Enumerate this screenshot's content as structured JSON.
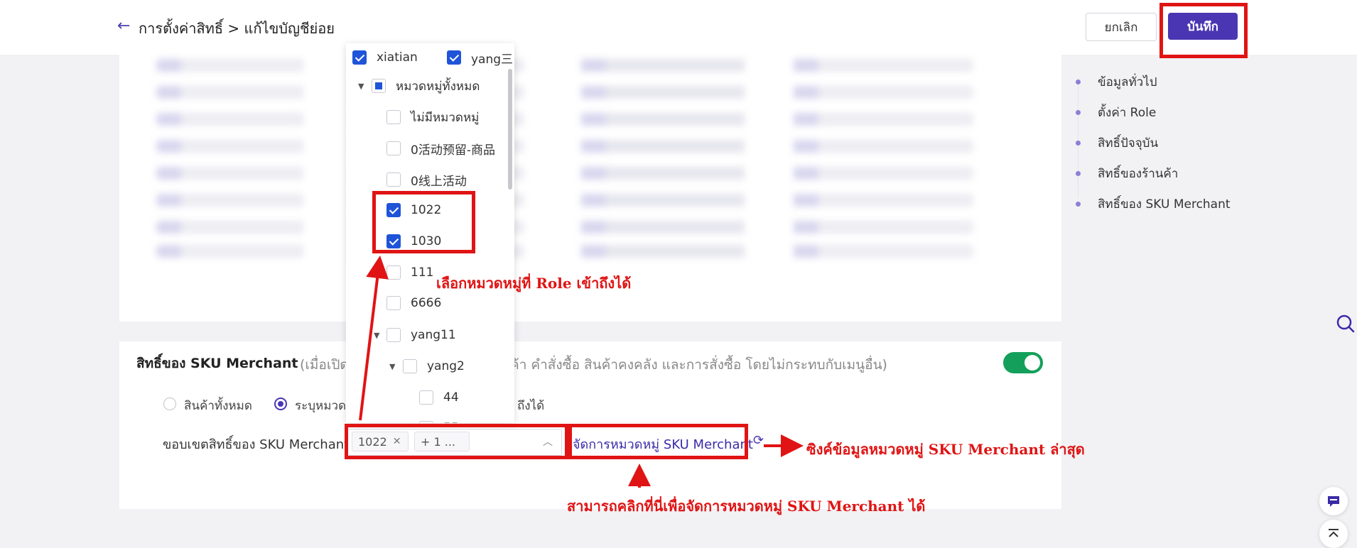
{
  "header": {
    "breadcrumb": "การตั้งค่าสิทธิ์ > แก้ไขบัญชีย่อย",
    "cancel_label": "ยกเลิก",
    "save_label": "บันทึก"
  },
  "anchor_nav": {
    "items": [
      {
        "label": "ข้อมูลทั่วไป"
      },
      {
        "label": "ตั้งค่า Role"
      },
      {
        "label": "สิทธิ์ปัจจุบัน"
      },
      {
        "label": "สิทธิ์ของร้านค้า"
      },
      {
        "label": "สิทธิ์ของ SKU Merchant"
      }
    ]
  },
  "sku_section": {
    "title": "สิทธิ์ของ SKU Merchant",
    "desc_prefix": "(เมื่อเปิด",
    "desc_suffix": "ค้า คำสั่งซื้อ สินค้าคงคลัง และการสั่งซื้อ โดยไม่กระทบกับเมนูอื่น)",
    "toggle_on": true,
    "radio_all": "สินค้าทั้งหมด",
    "radio_specific": "ระบุหมวด",
    "radio_tail": "ถึงได้",
    "scope_label": "ขอบเขตสิทธิ์ของ SKU Merchant:",
    "selected_tag": "1022",
    "more_tag": "+ 1 ...",
    "manage_link": "จัดการหมวดหมู่ SKU Merchant"
  },
  "dropdown": {
    "partial_top_1": "xiatian",
    "partial_top_2": "yang三",
    "items": [
      {
        "label": "หมวดหมู่ทั้งหมด",
        "state": "partial"
      },
      {
        "label": "ไม่มีหมวดหมู่",
        "state": "unchecked"
      },
      {
        "label": "0活动预留-商品",
        "state": "unchecked"
      },
      {
        "label": "0线上活动",
        "state": "unchecked"
      },
      {
        "label": "1022",
        "state": "checked"
      },
      {
        "label": "1030",
        "state": "checked"
      },
      {
        "label": "111",
        "state": "unchecked"
      },
      {
        "label": "6666",
        "state": "unchecked"
      },
      {
        "label": "yang11",
        "state": "unchecked"
      },
      {
        "label": "yang2",
        "state": "unchecked"
      },
      {
        "label": "44",
        "state": "unchecked"
      },
      {
        "label": "55",
        "state": "unchecked"
      }
    ]
  },
  "annotations": {
    "select_category": "เลือกหมวดหมู่ที่ Role เข้าถึงได้",
    "sync_latest": "ซิงค์ข้อมูลหมวดหมู่ SKU Merchant ล่าสุด",
    "click_manage": "สามารถคลิกที่นี่เพื่อจัดการหมวดหมู่ SKU Merchant ได้"
  },
  "colors": {
    "brand": "#4a36b3",
    "toggle_on": "#14a05b",
    "checkbox": "#1f54d8",
    "annotation_red": "#e01414"
  }
}
